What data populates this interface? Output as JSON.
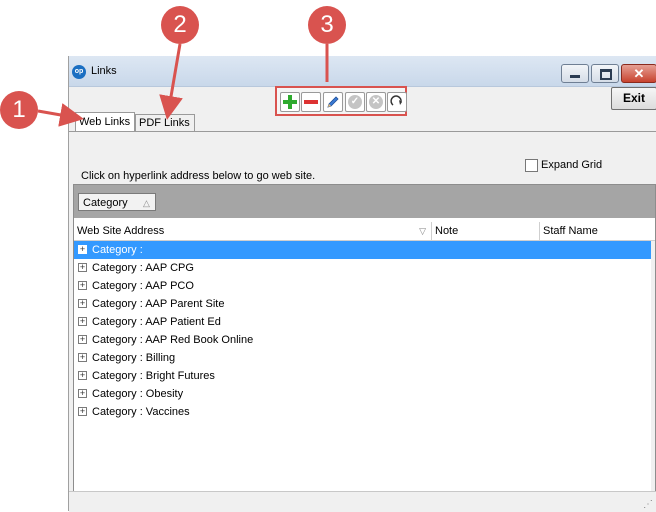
{
  "window": {
    "title": "Links",
    "exit_label": "Exit"
  },
  "tabs": [
    {
      "label": "Web Links"
    },
    {
      "label": "PDF Links"
    }
  ],
  "hint": "Click on hyperlink address below to go web site.",
  "expand_grid_label": "Expand Grid",
  "group_chip_label": "Category",
  "columns": [
    "Web Site Address",
    "Note",
    "Staff Name"
  ],
  "rows": [
    "Category :",
    "Category : AAP CPG",
    "Category : AAP PCO",
    "Category : AAP Parent Site",
    "Category : AAP Patient Ed",
    "Category : AAP Red Book Online",
    "Category : Billing",
    "Category : Bright Futures",
    "Category : Obesity",
    "Category : Vaccines"
  ],
  "callouts": [
    "1",
    "2",
    "3"
  ],
  "colors": {
    "accent": "#d9534f",
    "selection": "#3399ff",
    "group_panel": "#a5a5a5"
  },
  "toolbar_icons": [
    "add-icon",
    "delete-icon",
    "edit-icon",
    "confirm-icon",
    "cancel-icon",
    "refresh-icon"
  ]
}
